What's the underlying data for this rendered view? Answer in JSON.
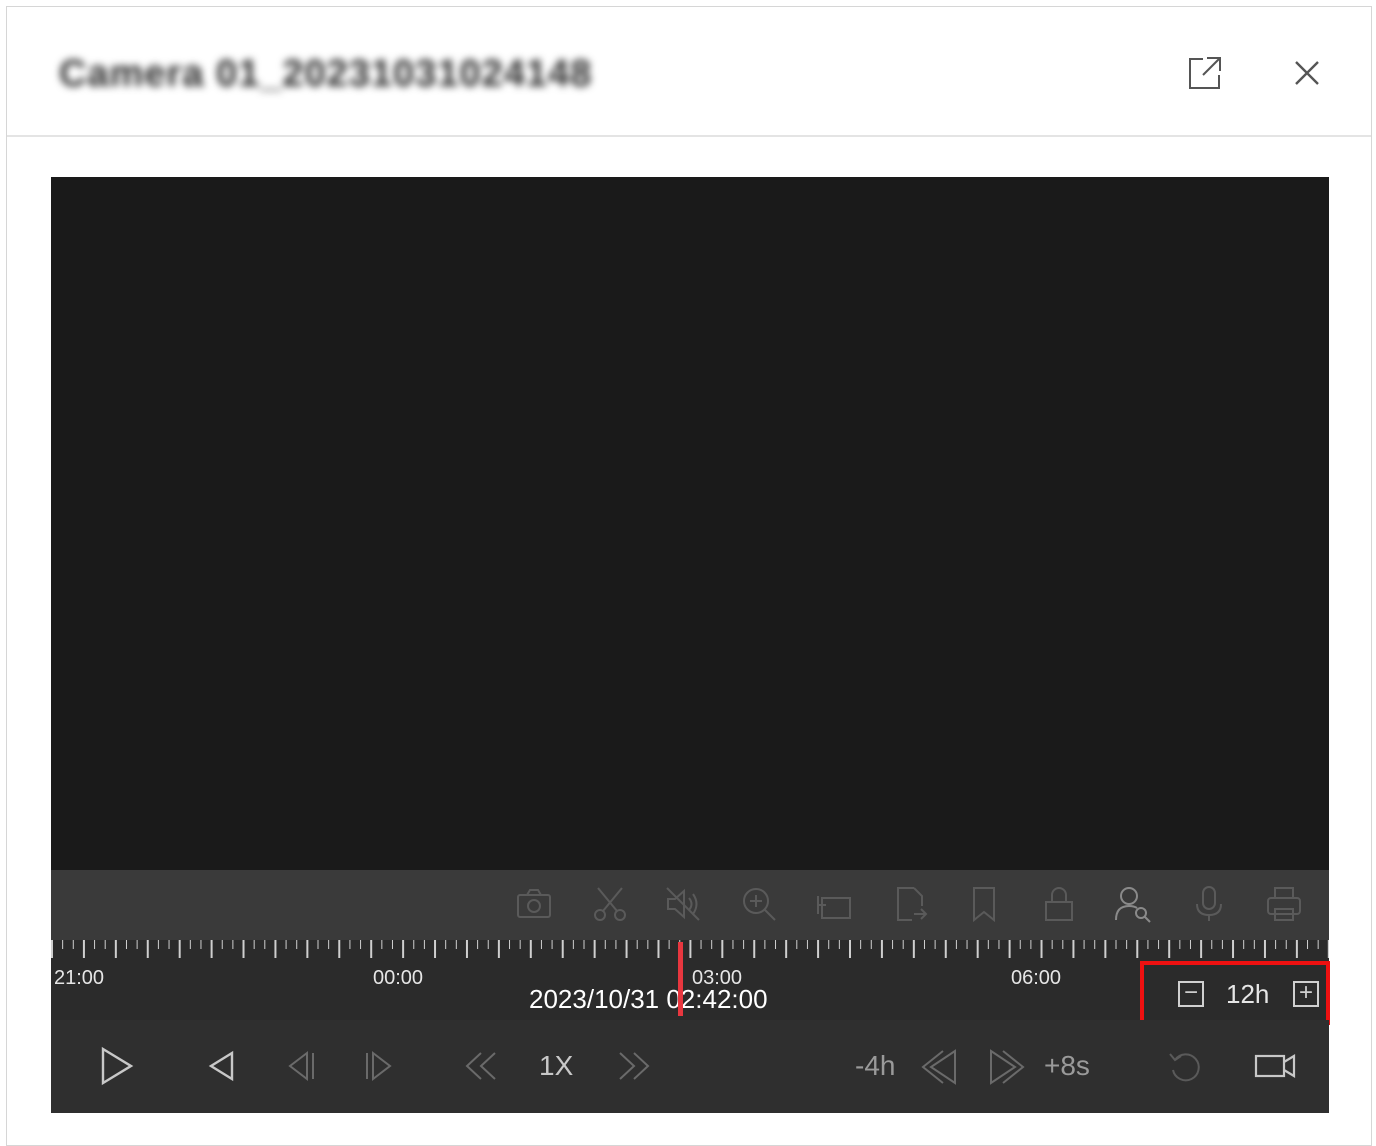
{
  "window": {
    "title": "Camera 01_20231031024148"
  },
  "toolbar": {
    "icons": [
      "camera-snapshot-icon",
      "scissors-clip-icon",
      "mute-icon",
      "digital-zoom-icon",
      "fisheye-icon",
      "export-icon",
      "bookmark-icon",
      "lock-icon",
      "person-search-icon",
      "microphone-icon",
      "print-icon"
    ]
  },
  "timeline": {
    "labels": [
      "21:00",
      "00:00",
      "03:00",
      "06:00"
    ],
    "current_time": "2023/10/31 02:42:00",
    "zoom": {
      "value": "12h",
      "minus": "−",
      "plus": "+"
    }
  },
  "controls": {
    "speed": "1X",
    "skip_back": "-4h",
    "skip_forward": "+8s"
  },
  "colors": {
    "video_bg": "#1a1a1a",
    "toolbar_bg": "#3a3a3a",
    "timeline_bg": "#2b2b2b",
    "cursor": "#e8373f",
    "highlight": "#ee1111"
  }
}
